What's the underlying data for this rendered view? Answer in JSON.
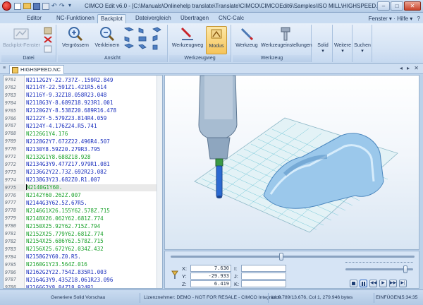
{
  "window": {
    "title": "CIMCO Edit v6.0 - [C:\\Manuals\\Onlinehelp translate\\Translate\\CIMCO\\CIMCOEdit6\\Samples\\ISO MILL\\HIGHSPEED.NC]",
    "minimize": "–",
    "maximize": "□",
    "close": "✕"
  },
  "ribbon_tabs": [
    "Editor",
    "NC-Funktionen",
    "Backplot",
    "Dateivergleich",
    "Übertragen",
    "CNC-Calc"
  ],
  "ribbon_tabs_active": "Backplot",
  "ribbon_right": {
    "window_menu": "Fenster",
    "help_menu": "Hilfe"
  },
  "groups": {
    "datei": {
      "label": "Datei",
      "backplot_fenster": "Backplot-Fenster"
    },
    "ansicht": {
      "label": "Ansicht",
      "zoom_in": "Vergrössern",
      "zoom_out": "Verkleinern"
    },
    "werkzeugweg": {
      "label": "Werkzeugweg",
      "toolpath": "Werkzeugweg",
      "modus": "Modus"
    },
    "werkzeug": {
      "label": "Werkzeug",
      "tool": "Werkzeug",
      "tool_settings": "Werkzeugeinstellungen"
    },
    "solid": "Solid",
    "weitere": "Weitere",
    "suchen": "Suchen"
  },
  "document": {
    "tab": "HIGHSPEED.NC",
    "nav": "◂ ▸ ✕"
  },
  "editor_lines": [
    {
      "n": "9761",
      "code": "N2112G2Y-22.737Z-.159R2.849",
      "color": "blue"
    },
    {
      "n": "9762",
      "code": "N2114Y-22.591Z1.421R5.614",
      "color": "blue"
    },
    {
      "n": "9763",
      "code": "N2116Y-9.32Z18.058R23.048",
      "color": "blue"
    },
    {
      "n": "9764",
      "code": "N2118G3Y-8.689Z18.923R1.001",
      "color": "blue"
    },
    {
      "n": "9765",
      "code": "N2120G2Y-8.538Z20.689R16.478",
      "color": "blue"
    },
    {
      "n": "9766",
      "code": "N2122Y-5.579Z23.814R4.059",
      "color": "blue"
    },
    {
      "n": "9767",
      "code": "N2124Y-4.176Z24.R5.741",
      "color": "blue"
    },
    {
      "n": "9768",
      "code": "N2126G1Y4.176",
      "color": "green"
    },
    {
      "n": "9769",
      "code": "N2128G2Y7.672Z22.496R4.507",
      "color": "blue"
    },
    {
      "n": "9770",
      "code": "N2130Y8.59Z20.279R3.795",
      "color": "blue"
    },
    {
      "n": "9771",
      "code": "N2132G1Y8.688Z18.928",
      "color": "green"
    },
    {
      "n": "9772",
      "code": "N2134G3Y9.477Z17.979R1.081",
      "color": "blue"
    },
    {
      "n": "9773",
      "code": "N2136G2Y22.73Z.692R23.082",
      "color": "blue"
    },
    {
      "n": "9774",
      "code": "N2138G3Y23.682Z0.R1.007",
      "color": "blue"
    },
    {
      "n": "9775",
      "code": "N2140G1Y60.",
      "color": "green"
    },
    {
      "n": "9776",
      "code": "N2142Y60.262Z.007",
      "color": "green"
    },
    {
      "n": "9777",
      "code": "N2144G3Y62.5Z.67R5.",
      "color": "blue"
    },
    {
      "n": "9778",
      "code": "N2146G1X26.155Y62.578Z.715",
      "color": "green"
    },
    {
      "n": "9779",
      "code": "N2148X26.062Y62.681Z.774",
      "color": "green"
    },
    {
      "n": "9780",
      "code": "N2150X25.92Y62.715Z.794",
      "color": "green"
    },
    {
      "n": "9781",
      "code": "N2152X25.779Y62.681Z.774",
      "color": "green"
    },
    {
      "n": "9782",
      "code": "N2154X25.686Y62.578Z.715",
      "color": "green"
    },
    {
      "n": "9783",
      "code": "N2156X25.672Y62.034Z.432",
      "color": "green"
    },
    {
      "n": "9784",
      "code": "N2158G2Y60.Z0.R5.",
      "color": "blue"
    },
    {
      "n": "9785",
      "code": "N2160G1Y23.564Z.016",
      "color": "green"
    },
    {
      "n": "9786",
      "code": "N2162G2Y22.754Z.835R1.003",
      "color": "blue"
    },
    {
      "n": "9787",
      "code": "N2164G3Y9.435Z18.061R23.096",
      "color": "blue"
    },
    {
      "n": "9788",
      "code": "N2166G2Y8.84Z18.924R1.",
      "color": "blue"
    }
  ],
  "current_line_index": 14,
  "coords": {
    "x_label": "X:",
    "x": "7.630",
    "y_label": "Y:",
    "y": "-29.933",
    "z_label": "Z:",
    "z": "6.419",
    "i_label": "I:",
    "j_label": "J:",
    "k_label": "K:"
  },
  "status": {
    "left": "Generiere Solid Vorschau",
    "license": "Lizenznehmer: DEMO - NOT FOR RESALE - CIMCO Integration",
    "position": "Ln 9.789/13.676, Col 1, 279.946 bytes",
    "mode": "EINFÜGEN",
    "time": "15:34:35"
  }
}
